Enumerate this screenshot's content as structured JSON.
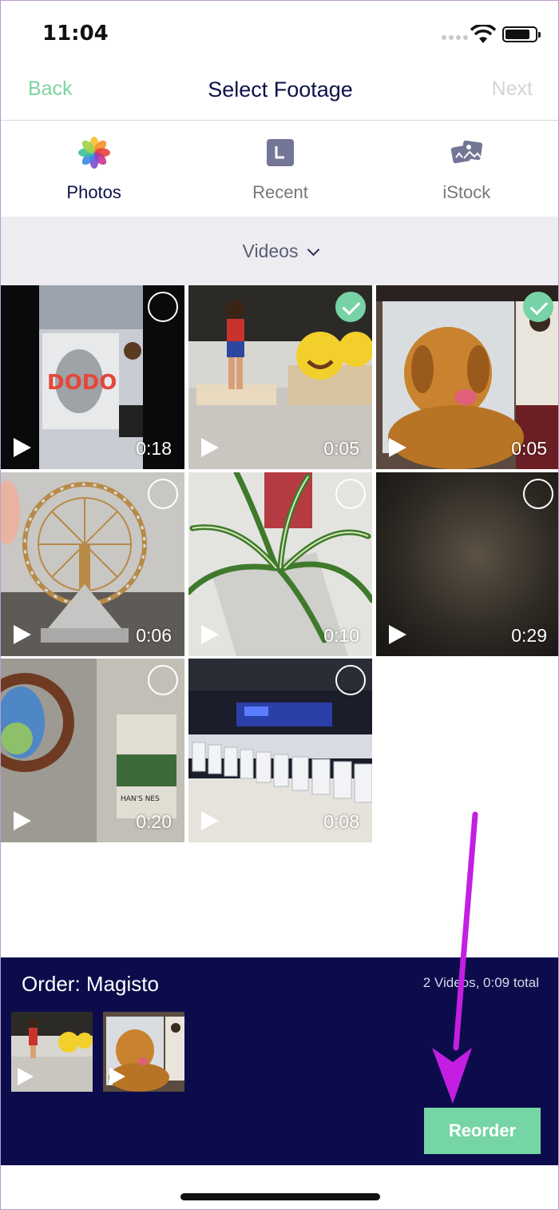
{
  "status": {
    "time": "11:04"
  },
  "nav": {
    "back": "Back",
    "title": "Select Footage",
    "next": "Next"
  },
  "tabs": [
    {
      "label": "Photos",
      "icon": "photos-icon",
      "active": true
    },
    {
      "label": "Recent",
      "icon": "recent-icon",
      "active": false
    },
    {
      "label": "iStock",
      "icon": "istock-icon",
      "active": false
    }
  ],
  "filter": {
    "label": "Videos"
  },
  "videos": [
    {
      "duration": "0:18",
      "selected": false
    },
    {
      "duration": "0:05",
      "selected": true
    },
    {
      "duration": "0:05",
      "selected": true
    },
    {
      "duration": "0:06",
      "selected": false
    },
    {
      "duration": "0:10",
      "selected": false
    },
    {
      "duration": "0:29",
      "selected": false
    },
    {
      "duration": "0:20",
      "selected": false
    },
    {
      "duration": "0:08",
      "selected": false
    }
  ],
  "order": {
    "title": "Order: Magisto",
    "summary": "2 Videos, 0:09 total",
    "reorder_label": "Reorder"
  },
  "colors": {
    "accent": "#77d3a5",
    "navy": "#0c0c4c",
    "arrow": "#c41ee3"
  }
}
